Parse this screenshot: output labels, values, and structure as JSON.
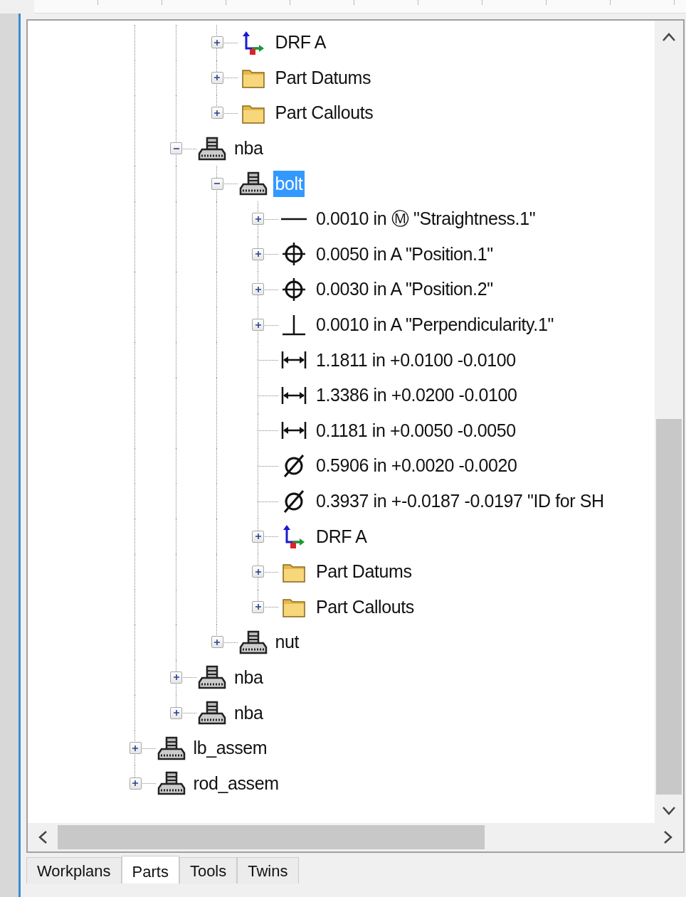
{
  "tree": {
    "items": [
      {
        "children": [
          {
            "children": [
              {
                "label": "DRF A",
                "kind": "csys",
                "expanded": false,
                "selected": false
              },
              {
                "label": "Part Datums",
                "kind": "folder",
                "expanded": false,
                "selected": false
              },
              {
                "label": "Part Callouts",
                "kind": "folder",
                "expanded": false,
                "selected": false
              }
            ]
          },
          {
            "label": "nba",
            "kind": "part",
            "expanded": true,
            "selected": false,
            "children": [
              {
                "label": "bolt",
                "kind": "part",
                "expanded": true,
                "selected": true,
                "children": [
                  {
                    "label": "0.0010 in Ⓜ \"Straightness.1\"",
                    "kind": "straightness",
                    "expanded": false,
                    "selected": false
                  },
                  {
                    "label": "0.0050 in A \"Position.1\"",
                    "kind": "position",
                    "expanded": false,
                    "selected": false
                  },
                  {
                    "label": "0.0030 in A \"Position.2\"",
                    "kind": "position",
                    "expanded": false,
                    "selected": false
                  },
                  {
                    "label": "0.0010 in A \"Perpendicularity.1\"",
                    "kind": "perpendicularity",
                    "expanded": false,
                    "selected": false
                  },
                  {
                    "label": "1.1811 in +0.0100 -0.0100",
                    "kind": "distance",
                    "selected": false
                  },
                  {
                    "label": "1.3386 in +0.0200 -0.0100",
                    "kind": "distance",
                    "selected": false
                  },
                  {
                    "label": "0.1181 in +0.0050 -0.0050",
                    "kind": "distance",
                    "selected": false
                  },
                  {
                    "label": "0.5906 in +0.0020 -0.0020",
                    "kind": "diameter",
                    "selected": false
                  },
                  {
                    "label": "0.3937 in +-0.0187 -0.0197 \"ID for SH",
                    "kind": "diameter",
                    "selected": false
                  },
                  {
                    "label": "DRF A",
                    "kind": "csys",
                    "expanded": false,
                    "selected": false
                  },
                  {
                    "label": "Part Datums",
                    "kind": "folder",
                    "expanded": false,
                    "selected": false
                  },
                  {
                    "label": "Part Callouts",
                    "kind": "folder",
                    "expanded": false,
                    "selected": false
                  }
                ]
              },
              {
                "label": "nut",
                "kind": "part",
                "expanded": false,
                "selected": false
              }
            ]
          },
          {
            "label": "nba",
            "kind": "part",
            "expanded": false,
            "selected": false
          },
          {
            "label": "nba",
            "kind": "part",
            "expanded": false,
            "selected": false
          }
        ]
      },
      {
        "label": "lb_assem",
        "kind": "part",
        "expanded": false,
        "selected": false
      },
      {
        "label": "rod_assem",
        "kind": "part",
        "expanded": false,
        "selected": false
      }
    ]
  },
  "tabs": [
    {
      "label": "Workplans",
      "selected": false
    },
    {
      "label": "Parts",
      "selected": true
    },
    {
      "label": "Tools",
      "selected": false
    },
    {
      "label": "Twins",
      "selected": false
    }
  ]
}
